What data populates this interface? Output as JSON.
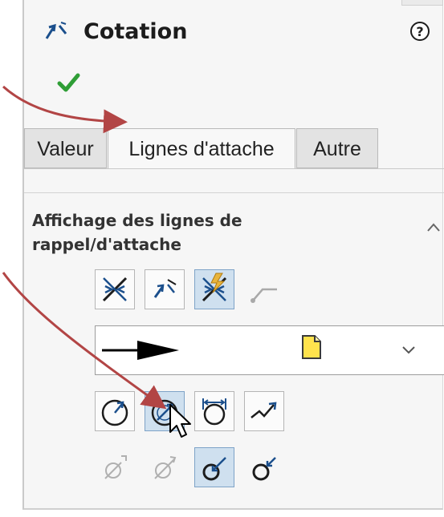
{
  "panel": {
    "title": "Cotation",
    "icons": {
      "title": "dimension-icon",
      "help": "help-icon",
      "ok": "checkmark-icon"
    }
  },
  "tabs": [
    {
      "label": "Valeur",
      "active": false
    },
    {
      "label": "Lignes d'attache",
      "active": true
    },
    {
      "label": "Autre",
      "active": false
    }
  ],
  "section": {
    "title": "Affichage des lignes de rappel/d'attache"
  },
  "leader_row1": [
    {
      "icon": "arrows-inside-icon",
      "selected": false
    },
    {
      "icon": "arrows-outside-icon",
      "selected": false
    },
    {
      "icon": "arrows-smart-icon",
      "selected": true
    },
    {
      "icon": "bent-leader-icon",
      "selected": false,
      "disabled": true
    }
  ],
  "arrow_style": {
    "preview_icon": "solid-arrowhead-icon",
    "doc_icon": "document-icon",
    "dropdown_icon": "chevron-down-icon"
  },
  "leader_row2": [
    {
      "icon": "radius-leader-icon",
      "selected": false
    },
    {
      "icon": "diameter-leader-icon",
      "selected": true
    },
    {
      "icon": "linear-diameter-icon",
      "selected": false
    },
    {
      "icon": "jogged-leader-icon",
      "selected": false
    }
  ],
  "leader_row3": [
    {
      "icon": "diameter-half-icon",
      "selected": false,
      "disabled": true
    },
    {
      "icon": "diameter-half-alt-icon",
      "selected": false,
      "disabled": true
    },
    {
      "icon": "diameter-inside-icon",
      "selected": true
    },
    {
      "icon": "diameter-outside-icon",
      "selected": false
    }
  ],
  "colors": {
    "accent_blue": "#1b4f8c",
    "selected_bg": "#cfe0ef",
    "check_green": "#2f9e36",
    "callout_red": "#b24545",
    "smart_yellow": "#e8b43c"
  }
}
